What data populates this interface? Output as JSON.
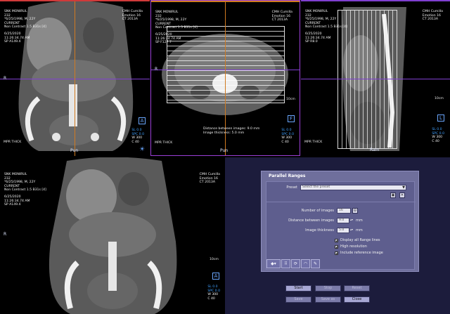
{
  "viewports": {
    "coronal": {
      "patient_name": "SNK MONIRUL",
      "patient_line2": "232",
      "patient_line3": "*6/25/1998, M, 22Y",
      "series": "CURRENT",
      "protocol": "Non Contrast 1.5 B31s [4]",
      "date": "6/25/2020",
      "time": "11:26:34.74 AM",
      "position": "SP A149.4",
      "institution": "CMH Cumilla",
      "station": "Emotion 16",
      "modality": "CT 2013A",
      "view_label": "A",
      "sl": "SL 0.0",
      "spc": "SPC 0.0",
      "w": "W   300",
      "c": "C     40",
      "thickness": "MPR THICK",
      "orient_left": "R",
      "orient_bottom": "Pun"
    },
    "axial": {
      "patient_name": "SNK MONIRUL",
      "patient_line2": "232",
      "patient_line3": "*6/25/1998, M, 22Y",
      "series": "CURRENT",
      "protocol": "Non Contrast 1.5 B31s [4]",
      "date": "6/25/2020",
      "time": "11:26:34.74 AM",
      "position": "SP F127.7",
      "institution": "CMH Cumilla",
      "station": "Emotion 16",
      "modality": "CT 2013A",
      "view_label": "F",
      "sl": "SL 0.0",
      "spc": "SPC 0.0",
      "w": "W   300",
      "c": "C     40",
      "thickness": "MPR THICK",
      "scale": "10cm",
      "distance_info": "Distance between images: 9.0 mm",
      "thickness_info": "Image thickness: 5.0 mm",
      "orient_left": "R",
      "orient_bottom": "Pun"
    },
    "sagittal": {
      "patient_name": "SNK MONIRUL",
      "patient_line2": "232",
      "patient_line3": "*6/25/1998, M, 22Y",
      "series": "CURRENT",
      "protocol": "Non Contrast 1.5 B31s [4]",
      "date": "6/25/2020",
      "time": "11:26:34.74 AM",
      "position": "SP R8.0",
      "institution": "CMH Cumilla",
      "station": "Emotion 16",
      "modality": "CT 2013A",
      "view_label": "L",
      "sl": "SL 0.0",
      "spc": "SPC 0.0",
      "w": "W   300",
      "c": "C     40",
      "thickness": "MPR THICK",
      "orient_bottom": "Rain",
      "scale": "10cm"
    },
    "coronal2": {
      "patient_name": "SNK MONIRUL",
      "patient_line2": "232",
      "patient_line3": "*6/25/1998, M, 22Y",
      "series": "CURRENT",
      "protocol": "Non Contrast 1.5 B31s [4]",
      "date": "6/25/2020",
      "time": "11:26:34.74 AM",
      "position": "SP A149.4",
      "institution": "CMH Cumilla",
      "station": "Emotion 16",
      "modality": "CT 2013A",
      "view_label": "A",
      "sl": "SL 0.0",
      "spc": "SPC 0.0",
      "w": "W   300",
      "c": "C     40",
      "scale": "10cm",
      "orient_left": "R"
    }
  },
  "dialog": {
    "title": "Parallel Ranges",
    "preset_label": "Preset",
    "preset_placeholder": "Select the preset",
    "num_images_label": "Number of images",
    "num_images_value": "16",
    "distance_label": "Distance between images",
    "distance_value": "9.0",
    "distance_unit": "mm",
    "thickness_label": "Image thickness",
    "thickness_value": "5.0",
    "thickness_unit": "mm",
    "opt_display_all": "Display all Range lines",
    "opt_high_res": "High resolution",
    "opt_include_ref": "Include reference image",
    "buttons": {
      "start": "Start",
      "stop": "Stop",
      "reset": "Reset",
      "save": "Save",
      "save_as": "Save as",
      "close": "Close"
    }
  },
  "colors": {
    "crosshair_horizontal": "#7f3fd0",
    "crosshair_vertical": "#d07a20",
    "active_border": "#9b3fd6",
    "dialog_bg": "#6f6f9c",
    "panel_bg": "#1c1c3c"
  }
}
